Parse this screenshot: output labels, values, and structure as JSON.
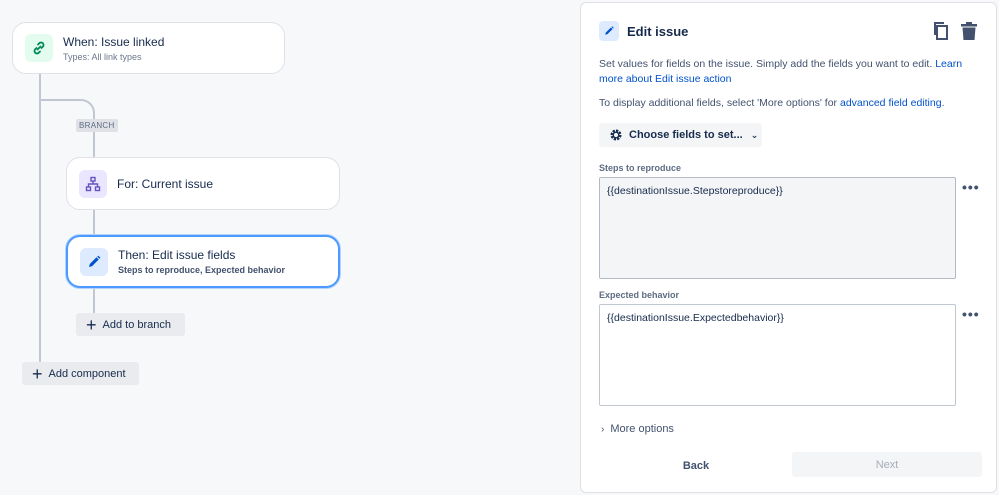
{
  "canvas": {
    "trigger": {
      "title": "When: Issue linked",
      "subtitle": "Types: All link types",
      "icon": "link-icon"
    },
    "branch_badge": "BRANCH",
    "branch_node": {
      "title": "For: Current issue",
      "icon": "branch-icon"
    },
    "action_node": {
      "title": "Then: Edit issue fields",
      "subtitle": "Steps to reproduce, Expected behavior",
      "icon": "pencil-icon"
    },
    "add_to_branch_label": "Add to branch",
    "add_component_label": "Add component"
  },
  "panel": {
    "title": "Edit issue",
    "description": "Set values for fields on the issue. Simply add the fields you want to edit.",
    "learn_more_link": "Learn more about Edit issue action",
    "additional_text": "To display additional fields, select 'More options' for",
    "advanced_link": "advanced field editing",
    "advanced_suffix": ".",
    "choose_fields_label": "Choose fields to set...",
    "fields": [
      {
        "label": "Steps to reproduce",
        "value": "{{destinationIssue.Stepstoreproduce}}"
      },
      {
        "label": "Expected behavior",
        "value": "{{destinationIssue.Expectedbehavior}}"
      }
    ],
    "field_menu_glyph": "•••",
    "more_options_label": "More options",
    "back_label": "Back",
    "next_label": "Next"
  },
  "colors": {
    "selected_border": "#4c9aff",
    "link_color": "#0052cc",
    "trigger_icon_bg": "#e3fcef",
    "branch_icon_bg": "#eae6ff",
    "action_icon_bg": "#deebff"
  }
}
